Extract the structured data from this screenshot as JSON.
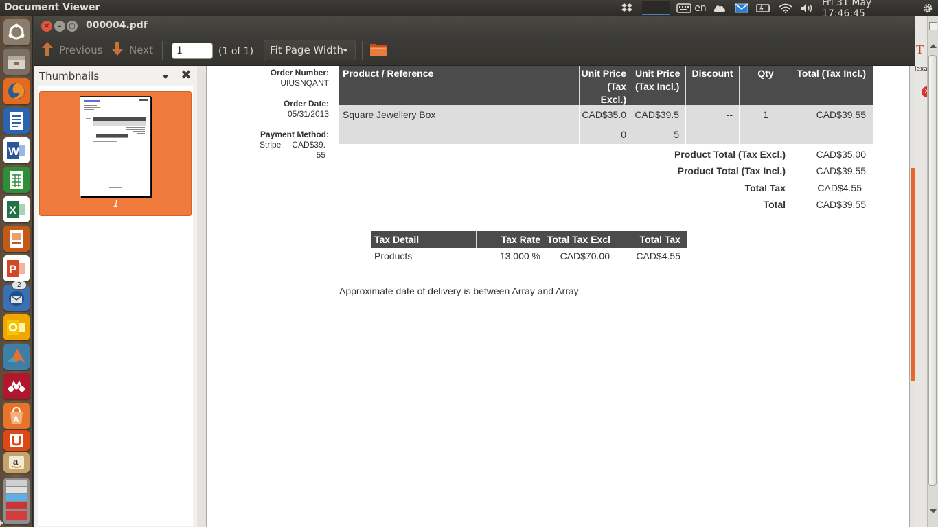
{
  "top_panel": {
    "app_title": "Document Viewer",
    "keyboard_layout": "en",
    "datetime": "Fri 31 May  17:46:45",
    "icons": [
      "dropbox-icon",
      "keyboard-icon",
      "cloud-icon",
      "mail-icon",
      "battery-icon",
      "wifi-icon",
      "volume-icon",
      "settings-gear-icon"
    ]
  },
  "launcher": {
    "items": [
      {
        "name": "ubuntu-dash",
        "color": "#8a7d6b"
      },
      {
        "name": "files",
        "color": "#7a6f63"
      },
      {
        "name": "firefox",
        "color": "#e46a1f"
      },
      {
        "name": "libreoffice-writer",
        "color": "#2a64b0"
      },
      {
        "name": "ms-word",
        "color": "#2b5797"
      },
      {
        "name": "libreoffice-calc",
        "color": "#2f8f38"
      },
      {
        "name": "ms-excel",
        "color": "#217346"
      },
      {
        "name": "libreoffice-impress",
        "color": "#c15a18"
      },
      {
        "name": "ms-powerpoint",
        "color": "#d24726"
      },
      {
        "name": "thunderbird",
        "color": "#3d6fb3",
        "badge": "2"
      },
      {
        "name": "ms-outlook",
        "color": "#f0a800"
      },
      {
        "name": "matlab",
        "color": "#3f7ea6"
      },
      {
        "name": "mendeley",
        "color": "#b0172d"
      },
      {
        "name": "software-center",
        "color": "#e8742c"
      },
      {
        "name": "ubuntu-one",
        "color": "#dd4814"
      },
      {
        "name": "amazon",
        "color": "#c4a46b"
      },
      {
        "name": "stacked-apps",
        "color": "#8e8e8e"
      }
    ]
  },
  "window": {
    "title": "000004.pdf"
  },
  "toolbar": {
    "previous_label": "Previous",
    "next_label": "Next",
    "page_value": "1",
    "page_count": "(1 of 1)",
    "zoom_label": "Fit Page Width"
  },
  "sidebar": {
    "title": "Thumbnails",
    "thumb_label": "1"
  },
  "document": {
    "order_number_label": "Order Number:",
    "order_number": "UIUSNQANT",
    "order_date_label": "Order Date:",
    "order_date": "05/31/2013",
    "payment_method_label": "Payment Method:",
    "payment_method": "Stripe",
    "payment_amount_line1": "CAD$39.",
    "payment_amount_line2": "55",
    "product_table": {
      "headers": [
        "Product / Reference",
        "Unit Price\n(Tax\nExcl.)",
        "Unit Price\n(Tax Incl.)",
        "Discount",
        "Qty",
        "Total (Tax Incl.)"
      ],
      "row": {
        "product": "Square Jewellery Box",
        "unit_excl_1": "CAD$35.0",
        "unit_excl_2": "0",
        "unit_incl_1": "CAD$39.5",
        "unit_incl_2": "5",
        "discount": "--",
        "qty": "1",
        "total": "CAD$39.55"
      }
    },
    "totals": [
      {
        "label": "Product Total (Tax Excl.)",
        "value": "CAD$35.00"
      },
      {
        "label": "Product Total (Tax Incl.)",
        "value": "CAD$39.55"
      },
      {
        "label": "Total Tax",
        "value": "CAD$4.55"
      },
      {
        "label": "Total",
        "value": "CAD$39.55"
      }
    ],
    "tax_table": {
      "headers": [
        "Tax Detail",
        "Tax Rate",
        "Total Tax Excl",
        "Total Tax"
      ],
      "row": [
        "Products",
        "13.000 %",
        "CAD$70.00",
        "CAD$4.55"
      ]
    },
    "delivery_note": "Approximate date of delivery is between Array and Array"
  },
  "colors": {
    "accent_orange": "#ef7a3b",
    "header_dark": "#4b4b4b",
    "row_gray": "#dddddd"
  }
}
